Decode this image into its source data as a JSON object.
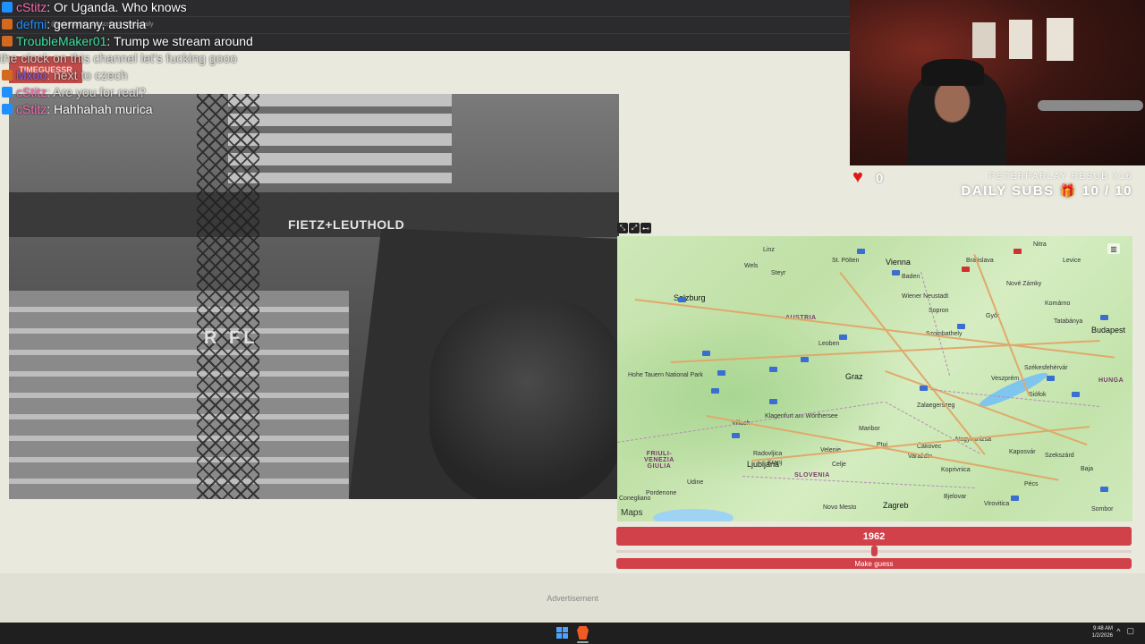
{
  "chat": [
    {
      "name": "cStitz",
      "message": ": Or Uganda. Who knows",
      "name_color": "#ff69b4",
      "icon_color": "#1e90ff",
      "faded": false
    },
    {
      "name": "defmi",
      "message": ": germany, austria",
      "name_color": "#1e90ff",
      "icon_color": "#d2691e",
      "faded": false
    },
    {
      "name": "TroubleMaker01",
      "message": ": Trump we stream around",
      "name_color": "#3fe0a0",
      "icon_color": "#d2691e",
      "faded": false
    },
    {
      "name": "",
      "message": "the clock on this channel let's fucking gooo",
      "name_color": "#ffffff",
      "icon_color": "",
      "faded": true
    },
    {
      "name": "Mxoo",
      "message": ": next to czech",
      "name_color": "#7b68ee",
      "icon_color": "#d2691e",
      "faded": true
    },
    {
      "name": "cStitz",
      "message": ": Are you for real?",
      "name_color": "#ff69b4",
      "icon_color": "#1e90ff",
      "faded": true
    },
    {
      "name": "cStitz",
      "message": ": Hahhahah murica",
      "name_color": "#ff69b4",
      "icon_color": "#1e90ff",
      "faded": false
    }
  ],
  "top_caption": "@peterparlay subscribed · threedaily",
  "logo_text": "TIMEGUESSR",
  "photo": {
    "sign_text": "FIETZ+LEUTHOLD",
    "sign_text_2": "R FL"
  },
  "stats": {
    "heart_count": "0",
    "resub_text": "PETERPARLAY RESUB X16",
    "daily_subs_label": "DAILY SUBS",
    "daily_subs_value": "10 / 10"
  },
  "map": {
    "brand": "Maps",
    "countries": [
      {
        "label": "AUSTRIA"
      },
      {
        "label": "SLOVENIA"
      },
      {
        "label": "FRIULI-\nVENEZIA\nGIULIA"
      },
      {
        "label": "HUNGA"
      }
    ],
    "cities": [
      {
        "label": "Linz"
      },
      {
        "label": "Vienna"
      },
      {
        "label": "Bratislava"
      },
      {
        "label": "Nitra"
      },
      {
        "label": "Levice"
      },
      {
        "label": "Wels"
      },
      {
        "label": "Steyr"
      },
      {
        "label": "St. Pölten"
      },
      {
        "label": "Baden"
      },
      {
        "label": "Salzburg"
      },
      {
        "label": "Wiener Neustadt"
      },
      {
        "label": "Sopron"
      },
      {
        "label": "Nové Zámky"
      },
      {
        "label": "Komárno"
      },
      {
        "label": "Győr"
      },
      {
        "label": "Tatabánya"
      },
      {
        "label": "Budapest"
      },
      {
        "label": "Leoben"
      },
      {
        "label": "Graz"
      },
      {
        "label": "Szombathely"
      },
      {
        "label": "Székesfehérvár"
      },
      {
        "label": "Veszprém"
      },
      {
        "label": "Siófok"
      },
      {
        "label": "Villach"
      },
      {
        "label": "Klagenfurt am Wörthersee"
      },
      {
        "label": "Maribor"
      },
      {
        "label": "Zalaegerszeg"
      },
      {
        "label": "Nagykanizsa"
      },
      {
        "label": "Kaposvár"
      },
      {
        "label": "Szekszárd"
      },
      {
        "label": "Ljubljana"
      },
      {
        "label": "Celje"
      },
      {
        "label": "Kranj"
      },
      {
        "label": "Velenje"
      },
      {
        "label": "Ptuj"
      },
      {
        "label": "Čakovec"
      },
      {
        "label": "Varaždin"
      },
      {
        "label": "Koprivnica"
      },
      {
        "label": "Zagreb"
      },
      {
        "label": "Pécs"
      },
      {
        "label": "Udine"
      },
      {
        "label": "Pordenone"
      },
      {
        "label": "Conegliano"
      },
      {
        "label": "Novo Mesto"
      },
      {
        "label": "Bjelovar"
      },
      {
        "label": "Virovitica"
      },
      {
        "label": "Sombor"
      },
      {
        "label": "Baja"
      },
      {
        "label": "Hohe Tauern National Park"
      },
      {
        "label": "Radovljica"
      }
    ]
  },
  "year": {
    "value": "1962",
    "fraction": 0.5
  },
  "guess_button": "Make guess",
  "ad_label": "Advertisement",
  "clock": {
    "time": "9:48 AM",
    "date": "1/2/2026"
  }
}
